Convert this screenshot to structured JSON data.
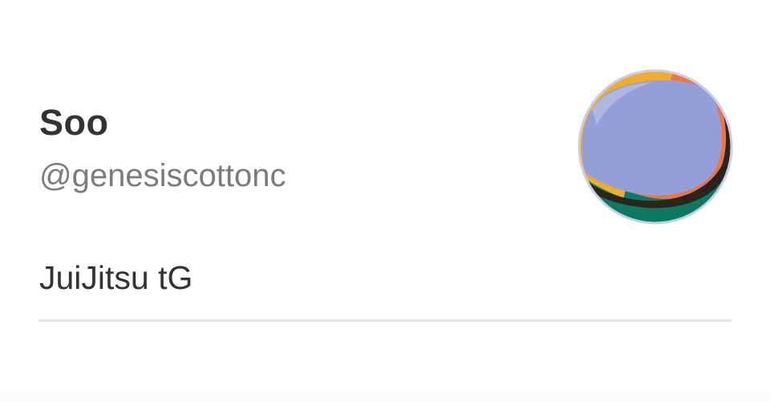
{
  "profile": {
    "name": "Soo",
    "handle": "@genesiscottonc",
    "bio": "JuiJitsu tG"
  },
  "avatar": {
    "icon": "abstract-sphere-avatar",
    "colors": {
      "main": "#949ed8",
      "top": "#f2ad27",
      "right": "#ef7440",
      "bottom": "#0c7a60",
      "shadow": "#2a241e"
    }
  },
  "colors": {
    "text": "#333333",
    "secondary_text": "#7c7c7c",
    "divider": "#e6e6e6"
  }
}
